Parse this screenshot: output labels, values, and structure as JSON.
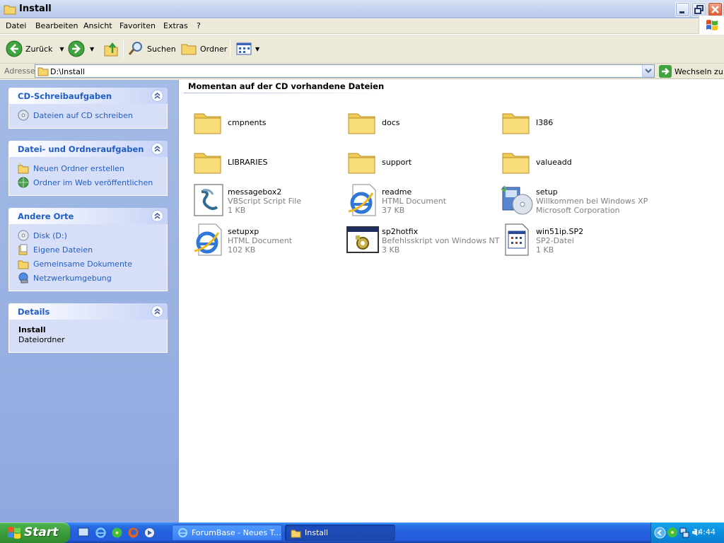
{
  "window": {
    "title": "Install"
  },
  "menu": [
    "Datei",
    "Bearbeiten",
    "Ansicht",
    "Favoriten",
    "Extras",
    "?"
  ],
  "toolbar": {
    "back": "Zurück",
    "search": "Suchen",
    "folders": "Ordner"
  },
  "address": {
    "label": "Adresse",
    "value": "D:\\Install",
    "go": "Wechseln zu"
  },
  "tasks": {
    "cd": {
      "title": "CD-Schreibaufgaben",
      "items": [
        "Dateien auf CD schreiben"
      ]
    },
    "file": {
      "title": "Datei- und Ordneraufgaben",
      "items": [
        "Neuen Ordner erstellen",
        "Ordner im Web veröffentlichen"
      ]
    },
    "places": {
      "title": "Andere Orte",
      "items": [
        "Disk (D:)",
        "Eigene Dateien",
        "Gemeinsame Dokumente",
        "Netzwerkumgebung"
      ]
    },
    "details": {
      "title": "Details",
      "name": "Install",
      "type": "Dateiordner"
    }
  },
  "main": {
    "group_header": "Momentan auf der CD vorhandene Dateien",
    "files": [
      {
        "name": "cmpnents",
        "icon": "folder-icon"
      },
      {
        "name": "docs",
        "icon": "folder-icon"
      },
      {
        "name": "I386",
        "icon": "folder-icon"
      },
      {
        "name": "LIBRARIES",
        "icon": "folder-icon"
      },
      {
        "name": "support",
        "icon": "folder-icon"
      },
      {
        "name": "valueadd",
        "icon": "folder-icon"
      },
      {
        "name": "messagebox2",
        "line1": "VBScript Script File",
        "line2": "1 KB",
        "icon": "vbscript-icon"
      },
      {
        "name": "readme",
        "line1": "HTML Document",
        "line2": "37 KB",
        "icon": "ie-html-icon"
      },
      {
        "name": "setup",
        "line1": "Willkommen bei Windows XP",
        "line2": "Microsoft Corporation",
        "icon": "setup-icon"
      },
      {
        "name": "setupxp",
        "line1": "HTML Document",
        "line2": "102 KB",
        "icon": "ie-html-icon"
      },
      {
        "name": "sp2hotfix",
        "line1": "Befehlsskript von Windows NT",
        "line2": "3 KB",
        "icon": "batch-icon"
      },
      {
        "name": "win51ip.SP2",
        "line1": "SP2-Datei",
        "line2": "1 KB",
        "icon": "generic-file-icon"
      }
    ]
  },
  "taskbar": {
    "start": "Start",
    "tasks": [
      "ForumBase - Neues T...",
      "Install"
    ],
    "clock": "14:44"
  },
  "colors": {
    "link": "#215dc6",
    "taskpane": "#a4bbe6",
    "taskbar": "#245edc"
  }
}
